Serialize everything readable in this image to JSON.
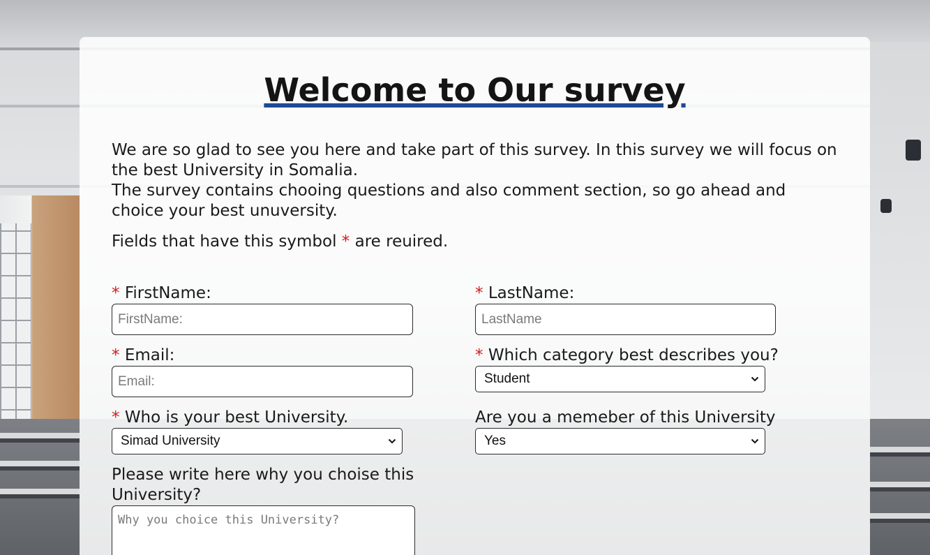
{
  "survey": {
    "title": "Welcome to Our survey",
    "intro_line1": "We are so glad to see you here and take part of this survey. In this survey we will focus on the best University in Somalia.",
    "intro_line2": "The survey contains chooing questions and also comment section, so go ahead and choice your best unuversity.",
    "required_note_before": "Fields that have this symbol",
    "required_symbol": "*",
    "required_note_after": "are reuired."
  },
  "fields": {
    "first_name": {
      "label": "FirstName:",
      "placeholder": "FirstName:"
    },
    "last_name": {
      "label": "LastName:",
      "placeholder": "LastName"
    },
    "email": {
      "label": "Email:",
      "placeholder": "Email:"
    },
    "category": {
      "label": "Which category best describes you?",
      "selected": "Student"
    },
    "university": {
      "label": "Who is your best University.",
      "selected": "Simad University"
    },
    "member": {
      "label": "Are you a memeber of this University",
      "selected": "Yes"
    },
    "reason": {
      "label": "Please write here why you choise this University?",
      "placeholder": "Why you choice this University?"
    }
  },
  "colors": {
    "required_star": "#d11a1a",
    "title_underline": "#1f4a94"
  }
}
